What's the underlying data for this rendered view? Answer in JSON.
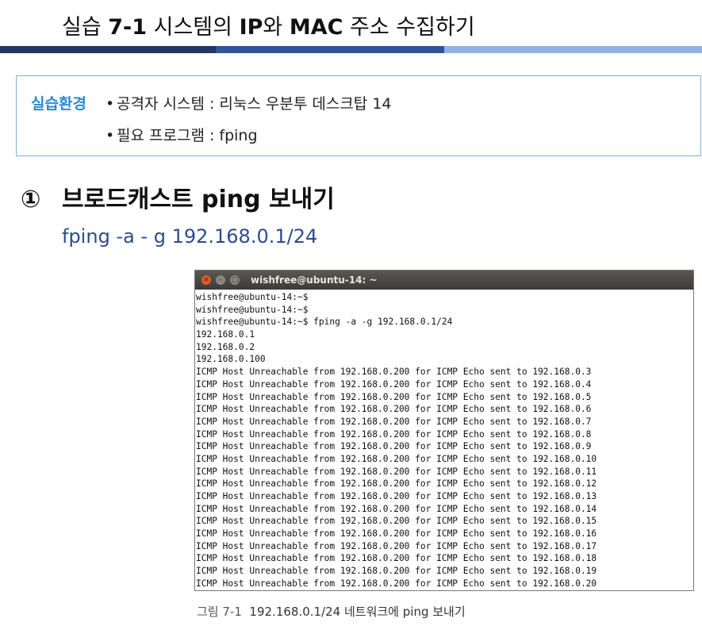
{
  "title": {
    "prefix": "실습 ",
    "number": "7-1",
    "part1": " 시스템의 ",
    "ip": "IP",
    "part2": "와 ",
    "mac": "MAC",
    "part3": " 주소 수집하기"
  },
  "colors": {
    "bar_dark": "#1f3864",
    "bar_mid": "#2e5597",
    "bar_light": "#8fb4e3",
    "accent": "#2a8bd1",
    "command": "#2b4c8c"
  },
  "environment": {
    "label": "실습환경",
    "items": [
      {
        "bullet": "•",
        "text": "공격자 시스템 : 리눅스 우분투 데스크탑 14"
      },
      {
        "bullet": "•",
        "text": "필요 프로그램 : fping"
      }
    ]
  },
  "step": {
    "number": "①",
    "title": "브로드캐스트 ping 보내기"
  },
  "command": "fping -a - g 192.168.0.1/24",
  "terminal": {
    "title": "wishfree@ubuntu-14: ~",
    "buttons": [
      "×",
      "–",
      "□"
    ],
    "lines": [
      "wishfree@ubuntu-14:~$",
      "wishfree@ubuntu-14:~$",
      "wishfree@ubuntu-14:~$ fping -a -g 192.168.0.1/24",
      "192.168.0.1",
      "192.168.0.2",
      "192.168.0.100",
      "ICMP Host Unreachable from 192.168.0.200 for ICMP Echo sent to 192.168.0.3",
      "ICMP Host Unreachable from 192.168.0.200 for ICMP Echo sent to 192.168.0.4",
      "ICMP Host Unreachable from 192.168.0.200 for ICMP Echo sent to 192.168.0.5",
      "ICMP Host Unreachable from 192.168.0.200 for ICMP Echo sent to 192.168.0.6",
      "ICMP Host Unreachable from 192.168.0.200 for ICMP Echo sent to 192.168.0.7",
      "ICMP Host Unreachable from 192.168.0.200 for ICMP Echo sent to 192.168.0.8",
      "ICMP Host Unreachable from 192.168.0.200 for ICMP Echo sent to 192.168.0.9",
      "ICMP Host Unreachable from 192.168.0.200 for ICMP Echo sent to 192.168.0.10",
      "ICMP Host Unreachable from 192.168.0.200 for ICMP Echo sent to 192.168.0.11",
      "ICMP Host Unreachable from 192.168.0.200 for ICMP Echo sent to 192.168.0.12",
      "ICMP Host Unreachable from 192.168.0.200 for ICMP Echo sent to 192.168.0.13",
      "ICMP Host Unreachable from 192.168.0.200 for ICMP Echo sent to 192.168.0.14",
      "ICMP Host Unreachable from 192.168.0.200 for ICMP Echo sent to 192.168.0.15",
      "ICMP Host Unreachable from 192.168.0.200 for ICMP Echo sent to 192.168.0.16",
      "ICMP Host Unreachable from 192.168.0.200 for ICMP Echo sent to 192.168.0.17",
      "ICMP Host Unreachable from 192.168.0.200 for ICMP Echo sent to 192.168.0.18",
      "ICMP Host Unreachable from 192.168.0.200 for ICMP Echo sent to 192.168.0.19",
      "ICMP Host Unreachable from 192.168.0.200 for ICMP Echo sent to 192.168.0.20"
    ]
  },
  "caption": {
    "label": "그림 7-1",
    "text": "192.168.0.1/24 네트워크에 ping 보내기"
  }
}
